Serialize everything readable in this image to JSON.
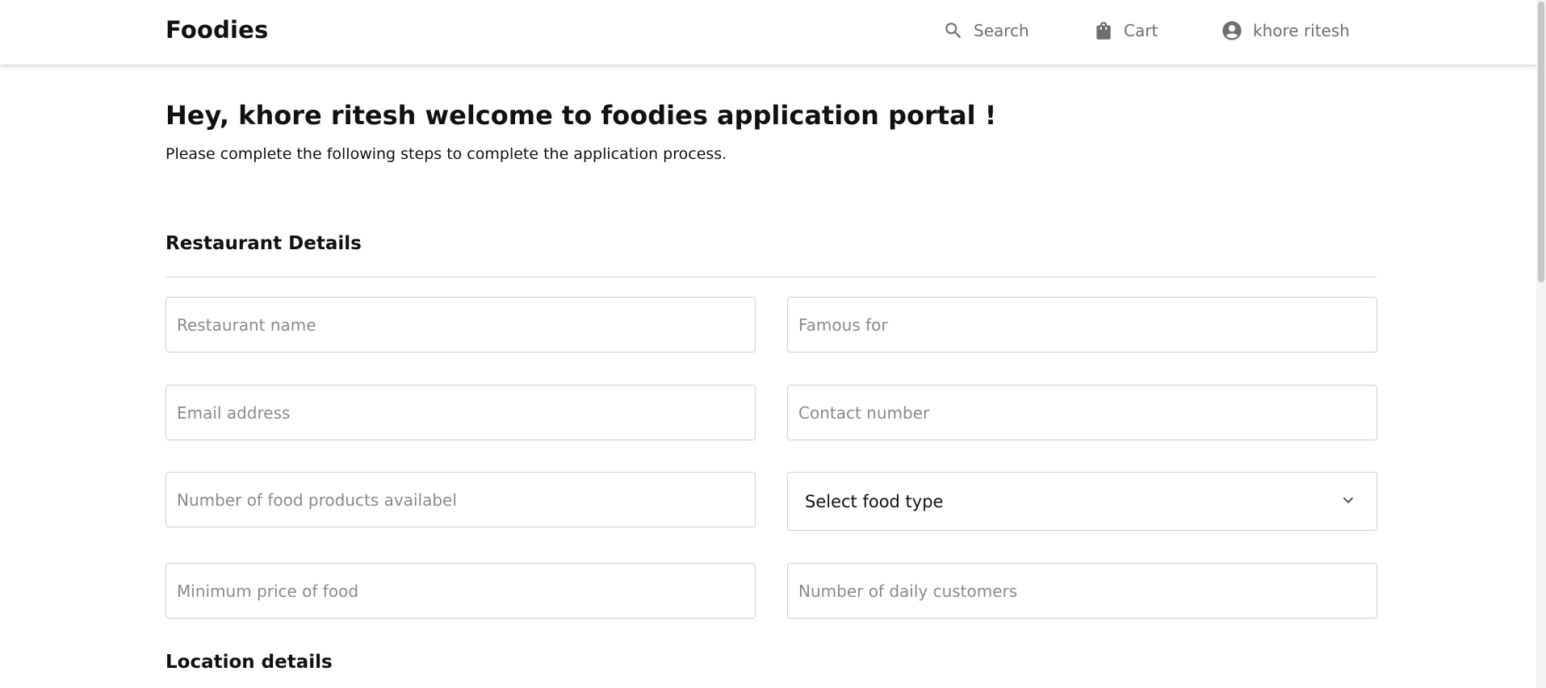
{
  "header": {
    "brand": "Foodies",
    "nav": {
      "search_label": "Search",
      "search_icon": "search-icon",
      "cart_label": "Cart",
      "cart_icon": "shopping-bag-icon",
      "user_label": "khore ritesh",
      "user_icon": "account-circle-icon"
    }
  },
  "main": {
    "welcome_title": "Hey, khore ritesh welcome to foodies application portal !",
    "subtitle": "Please complete the following steps to complete the application process.",
    "restaurant_section": {
      "title": "Restaurant Details",
      "fields": {
        "restaurant_name": {
          "placeholder": "Restaurant name",
          "value": ""
        },
        "famous_for": {
          "placeholder": "Famous for",
          "value": ""
        },
        "email": {
          "placeholder": "Email address",
          "value": ""
        },
        "contact_number": {
          "placeholder": "Contact number",
          "value": ""
        },
        "food_products_count": {
          "placeholder": "Number of food products availabel",
          "value": ""
        },
        "food_type": {
          "selected": "Select food type",
          "icon": "chevron-down-icon"
        },
        "min_price": {
          "placeholder": "Minimum price of food",
          "value": ""
        },
        "daily_customers": {
          "placeholder": "Number of daily customers",
          "value": ""
        }
      }
    },
    "location_section": {
      "title": "Location details"
    }
  },
  "colors": {
    "text_primary": "#111111",
    "text_muted": "#6f6f6f",
    "placeholder": "#8a8a8a",
    "border": "#cfcfcf",
    "background": "#ffffff"
  }
}
